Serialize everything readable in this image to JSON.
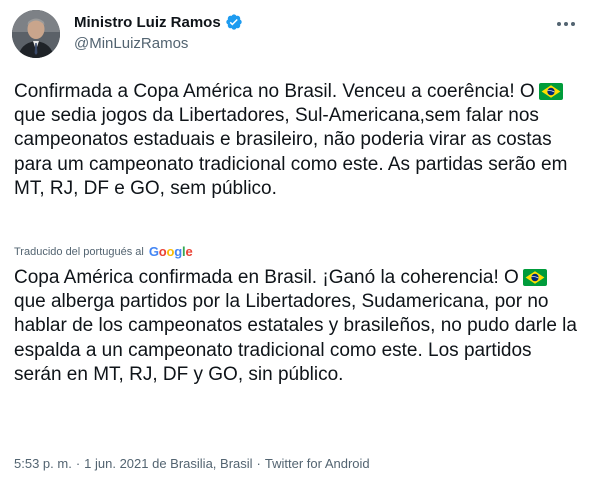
{
  "author": {
    "display_name": "Ministro Luiz Ramos",
    "handle": "@MinLuizRamos",
    "verified": true,
    "avatar": "profile-photo"
  },
  "tweet": {
    "original": {
      "part1": "Confirmada a Copa América no Brasil. Venceu a coerência! O",
      "flag": "flag-brazil",
      "part2": "que sedia jogos da Libertadores, Sul-Americana,sem falar nos campeonatos estaduais e brasileiro, não poderia virar as costas para um campeonato tradicional como este. As partidas serão em  MT, RJ, DF e GO, sem público."
    },
    "translated_by": {
      "label": "Traducido del portugués al",
      "provider": "Google",
      "provider_letters": [
        "G",
        "o",
        "o",
        "g",
        "l",
        "e"
      ]
    },
    "translation": {
      "part1": "Copa América confirmada en Brasil. ¡Ganó la coherencia! O",
      "flag": "flag-brazil",
      "part2": "que alberga partidos por la Libertadores, Sudamericana, por no hablar de los campeonatos estatales y brasileños, no pudo darle la espalda a un campeonato tradicional como este. Los partidos serán en MT, RJ, DF y GO, sin público."
    }
  },
  "meta": {
    "time": "5:53 p. m.",
    "date_place": "1 jun. 2021 de Brasilia, Brasil",
    "source": "Twitter for Android",
    "separator": "·"
  },
  "icons": {
    "more": "more-horizontal-icon",
    "verified": "verified-badge-icon"
  },
  "colors": {
    "text_primary": "#0f1419",
    "text_secondary": "#536471",
    "verified_blue": "#1d9bf0",
    "flag_green": "#009c3b",
    "flag_yellow": "#ffdf00",
    "flag_blue": "#002776"
  }
}
